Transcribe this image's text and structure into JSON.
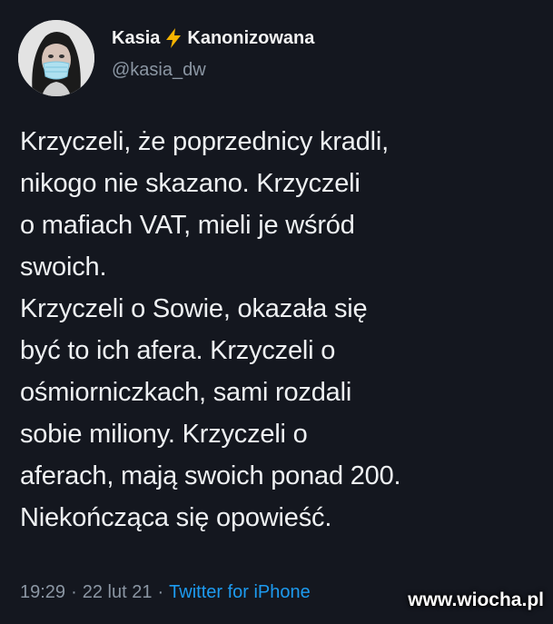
{
  "author": {
    "display_name_part1": "Kasia",
    "display_name_part2": "Kanonizowana",
    "lightning_icon": "lightning-icon",
    "handle": "@kasia_dw"
  },
  "tweet": {
    "text": "Krzyczeli, że poprzednicy kradli,\nnikogo nie skazano. Krzyczeli\no mafiach VAT, mieli je wśród\nswoich.\nKrzyczeli o Sowie, okazała się\nbyć to ich afera. Krzyczeli o\nośmiorniczkach, sami rozdali\nsobie miliony. Krzyczeli o\naferach, mają swoich ponad 200.\nNiekończąca się opowieść."
  },
  "meta": {
    "time": "19:29",
    "sep1": "·",
    "date": "22 lut 21",
    "sep2": "·",
    "source": "Twitter for iPhone"
  },
  "watermark": "www.wiocha.pl"
}
